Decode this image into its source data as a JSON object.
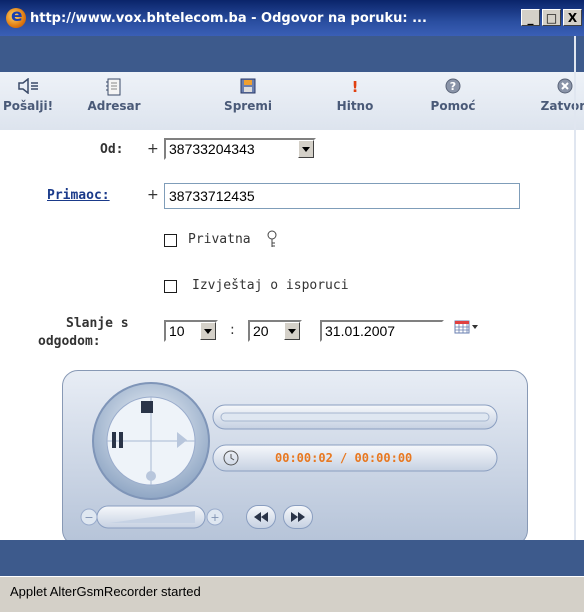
{
  "window": {
    "title": "http://www.vox.bhtelecom.ba - Odgovor na poruku: ...",
    "min_label": "_",
    "max_label": "□",
    "close_label": "X"
  },
  "toolbar": {
    "send": "Pošalji!",
    "address_book": "Adresar",
    "save": "Spremi",
    "urgent": "Hitno",
    "help": "Pomoć",
    "close": "Zatvori"
  },
  "form": {
    "from_label": "Od:",
    "from_prefix": "+",
    "from_value": "38733204343",
    "to_label": "Primaoc:",
    "to_prefix": "+",
    "to_value": "38733712435",
    "private_label": "Privatna",
    "private_checked": false,
    "report_label": "Izvještaj o isporuci",
    "report_checked": false,
    "delay_label_1": "Slanje s",
    "delay_label_2": "odgodom:",
    "hour": "10",
    "time_sep": ":",
    "minute": "20",
    "date": "31.01.2007"
  },
  "player": {
    "time_text": "00:00:02 / 00:00:00",
    "progress": 0.0,
    "accent_color": "#e87820"
  },
  "status": {
    "text": "Applet AlterGsmRecorder started"
  }
}
